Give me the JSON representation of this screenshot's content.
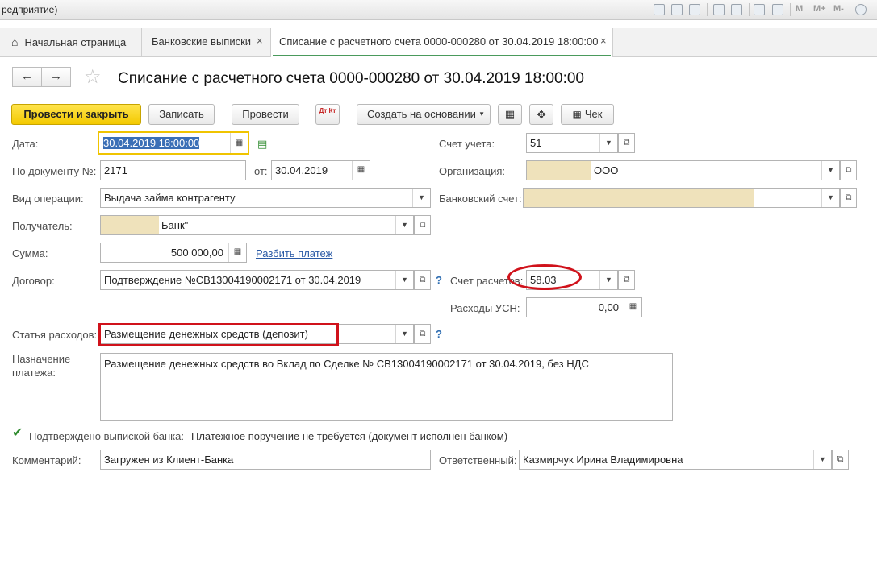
{
  "window": {
    "title_fragment": "редприятие)"
  },
  "toolbar_mem": {
    "m": "M",
    "m_plus": "M+",
    "m_minus": "M-"
  },
  "tabs": [
    {
      "label": "Начальная страница"
    },
    {
      "label": "Банковские выписки",
      "close": "×"
    },
    {
      "label": "Списание с расчетного счета 0000-000280 от 30.04.2019 18:00:00",
      "close": "×"
    }
  ],
  "nav": {
    "back": "←",
    "forward": "→"
  },
  "doc_title": "Списание с расчетного счета 0000-000280 от 30.04.2019 18:00:00",
  "actions": {
    "post_close": "Провести и закрыть",
    "save": "Записать",
    "post": "Провести",
    "dt_kt": "Дт Кт",
    "create_based": "Создать на основании",
    "check": "Чек"
  },
  "form": {
    "date_label": "Дата:",
    "date_value": "30.04.2019 18:00:00",
    "by_doc_label": "По документу №:",
    "by_doc_value": "2171",
    "from_label": "от:",
    "from_value": "30.04.2019",
    "operation_label": "Вид операции:",
    "operation_value": "Выдача займа контрагенту",
    "recipient_label": "Получатель:",
    "recipient_value": "Банк\"",
    "sum_label": "Сумма:",
    "sum_value": "500 000,00",
    "split_link": "Разбить платеж",
    "contract_label": "Договор:",
    "contract_value": "Подтверждение №CB13004190002171 от 30.04.2019",
    "expense_label": "Статья расходов:",
    "expense_value": "Размещение денежных средств (депозит)",
    "purpose_label_1": "Назначение",
    "purpose_label_2": "платежа:",
    "purpose_value": "Размещение денежных средств во Вклад по Сделке № CB13004190002171 от 30.04.2019, без НДС",
    "account_label": "Счет учета:",
    "account_value": "51",
    "org_label": "Организация:",
    "org_value": "ООО",
    "bank_acc_label": "Банковский счет:",
    "settle_label": "Счет расчетов:",
    "settle_value": "58.03",
    "usn_label": "Расходы УСН:",
    "usn_value": "0,00",
    "confirmed_label": "Подтверждено выпиской банка:",
    "confirmed_note": "Платежное поручение не требуется (документ исполнен банком)",
    "comment_label": "Комментарий:",
    "comment_value": "Загружен из Клиент-Банка",
    "responsible_label": "Ответственный:",
    "responsible_value": "Казмирчук Ирина Владимировна",
    "question": "?"
  },
  "colors": {
    "primary_button": "#f3c900",
    "highlight": "#d0121b",
    "active_tab_underline": "#4a9a5c"
  }
}
